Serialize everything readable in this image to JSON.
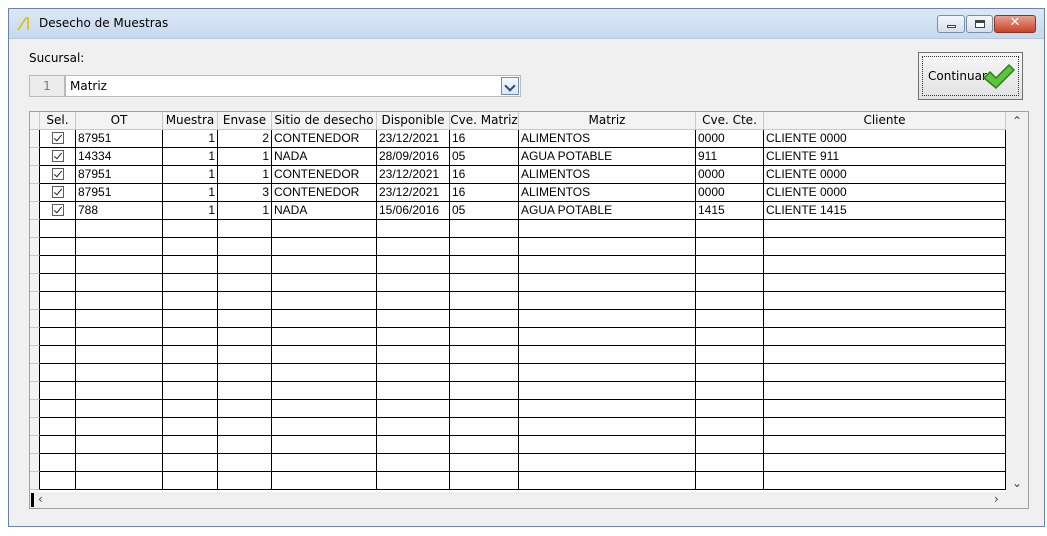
{
  "window": {
    "title": "Desecho de Muestras"
  },
  "form": {
    "sucursal_label": "Sucursal:",
    "sucursal_id": "1",
    "sucursal_value": "Matriz",
    "continuar_label": "Continuar"
  },
  "table": {
    "columns": [
      "Sel.",
      "OT",
      "Muestra",
      "Envase",
      "Sitio de desecho",
      "Disponible",
      "Cve. Matriz",
      "Matriz",
      "Cve. Cte.",
      "Cliente"
    ],
    "rows": [
      {
        "sel": true,
        "ot": "87951",
        "muestra": "1",
        "envase": "2",
        "sitio": "CONTENEDOR",
        "disponible": "23/12/2021",
        "cve_matriz": "16",
        "matriz": "ALIMENTOS",
        "cve_cte": "0000",
        "cliente": "CLIENTE 0000"
      },
      {
        "sel": true,
        "ot": "14334",
        "muestra": "1",
        "envase": "1",
        "sitio": "NADA",
        "disponible": "28/09/2016",
        "cve_matriz": "05",
        "matriz": "AGUA POTABLE",
        "cve_cte": "911",
        "cliente": "CLIENTE 911"
      },
      {
        "sel": true,
        "ot": "87951",
        "muestra": "1",
        "envase": "1",
        "sitio": "CONTENEDOR",
        "disponible": "23/12/2021",
        "cve_matriz": "16",
        "matriz": "ALIMENTOS",
        "cve_cte": "0000",
        "cliente": "CLIENTE 0000"
      },
      {
        "sel": true,
        "ot": "87951",
        "muestra": "1",
        "envase": "3",
        "sitio": "CONTENEDOR",
        "disponible": "23/12/2021",
        "cve_matriz": "16",
        "matriz": "ALIMENTOS",
        "cve_cte": "0000",
        "cliente": "CLIENTE 0000"
      },
      {
        "sel": true,
        "ot": "788",
        "muestra": "1",
        "envase": "1",
        "sitio": "NADA",
        "disponible": "15/06/2016",
        "cve_matriz": "05",
        "matriz": "AGUA POTABLE",
        "cve_cte": "1415",
        "cliente": "CLIENTE 1415"
      }
    ],
    "empty_rows": 15
  },
  "colors": {
    "titlebar": "#c7d9ee",
    "check_green": "#3fae2a"
  }
}
